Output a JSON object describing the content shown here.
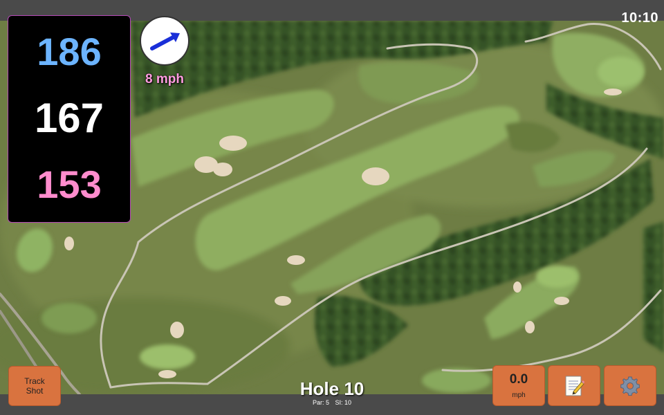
{
  "status_bar": {
    "time": "10:10"
  },
  "distances": {
    "back": "186",
    "center": "167",
    "front": "153"
  },
  "wind": {
    "speed_label": "8 mph",
    "icon": "wind-arrow-icon",
    "direction": "north-east"
  },
  "hole": {
    "title": "Hole 10",
    "par_label": "Par: 5",
    "si_label": "SI: 10"
  },
  "buttons": {
    "track_shot_label": "Track\nShot",
    "speed_value": "0.0",
    "speed_unit": "mph",
    "scorecard_icon": "scorecard-icon",
    "settings_icon": "gear-icon"
  },
  "colors": {
    "back_distance": "#6cb4ff",
    "center_distance": "#ffffff",
    "front_distance": "#ff8ccd",
    "button": "#d9733f",
    "panel_border": "#b54ab8"
  }
}
